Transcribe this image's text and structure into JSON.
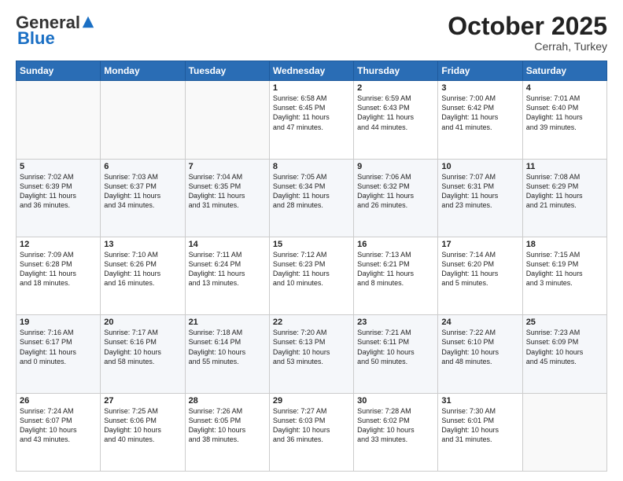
{
  "header": {
    "logo_general": "General",
    "logo_blue": "Blue",
    "month_title": "October 2025",
    "location": "Cerrah, Turkey"
  },
  "days_of_week": [
    "Sunday",
    "Monday",
    "Tuesday",
    "Wednesday",
    "Thursday",
    "Friday",
    "Saturday"
  ],
  "weeks": [
    [
      {
        "day": "",
        "info": ""
      },
      {
        "day": "",
        "info": ""
      },
      {
        "day": "",
        "info": ""
      },
      {
        "day": "1",
        "info": "Sunrise: 6:58 AM\nSunset: 6:45 PM\nDaylight: 11 hours\nand 47 minutes."
      },
      {
        "day": "2",
        "info": "Sunrise: 6:59 AM\nSunset: 6:43 PM\nDaylight: 11 hours\nand 44 minutes."
      },
      {
        "day": "3",
        "info": "Sunrise: 7:00 AM\nSunset: 6:42 PM\nDaylight: 11 hours\nand 41 minutes."
      },
      {
        "day": "4",
        "info": "Sunrise: 7:01 AM\nSunset: 6:40 PM\nDaylight: 11 hours\nand 39 minutes."
      }
    ],
    [
      {
        "day": "5",
        "info": "Sunrise: 7:02 AM\nSunset: 6:39 PM\nDaylight: 11 hours\nand 36 minutes."
      },
      {
        "day": "6",
        "info": "Sunrise: 7:03 AM\nSunset: 6:37 PM\nDaylight: 11 hours\nand 34 minutes."
      },
      {
        "day": "7",
        "info": "Sunrise: 7:04 AM\nSunset: 6:35 PM\nDaylight: 11 hours\nand 31 minutes."
      },
      {
        "day": "8",
        "info": "Sunrise: 7:05 AM\nSunset: 6:34 PM\nDaylight: 11 hours\nand 28 minutes."
      },
      {
        "day": "9",
        "info": "Sunrise: 7:06 AM\nSunset: 6:32 PM\nDaylight: 11 hours\nand 26 minutes."
      },
      {
        "day": "10",
        "info": "Sunrise: 7:07 AM\nSunset: 6:31 PM\nDaylight: 11 hours\nand 23 minutes."
      },
      {
        "day": "11",
        "info": "Sunrise: 7:08 AM\nSunset: 6:29 PM\nDaylight: 11 hours\nand 21 minutes."
      }
    ],
    [
      {
        "day": "12",
        "info": "Sunrise: 7:09 AM\nSunset: 6:28 PM\nDaylight: 11 hours\nand 18 minutes."
      },
      {
        "day": "13",
        "info": "Sunrise: 7:10 AM\nSunset: 6:26 PM\nDaylight: 11 hours\nand 16 minutes."
      },
      {
        "day": "14",
        "info": "Sunrise: 7:11 AM\nSunset: 6:24 PM\nDaylight: 11 hours\nand 13 minutes."
      },
      {
        "day": "15",
        "info": "Sunrise: 7:12 AM\nSunset: 6:23 PM\nDaylight: 11 hours\nand 10 minutes."
      },
      {
        "day": "16",
        "info": "Sunrise: 7:13 AM\nSunset: 6:21 PM\nDaylight: 11 hours\nand 8 minutes."
      },
      {
        "day": "17",
        "info": "Sunrise: 7:14 AM\nSunset: 6:20 PM\nDaylight: 11 hours\nand 5 minutes."
      },
      {
        "day": "18",
        "info": "Sunrise: 7:15 AM\nSunset: 6:19 PM\nDaylight: 11 hours\nand 3 minutes."
      }
    ],
    [
      {
        "day": "19",
        "info": "Sunrise: 7:16 AM\nSunset: 6:17 PM\nDaylight: 11 hours\nand 0 minutes."
      },
      {
        "day": "20",
        "info": "Sunrise: 7:17 AM\nSunset: 6:16 PM\nDaylight: 10 hours\nand 58 minutes."
      },
      {
        "day": "21",
        "info": "Sunrise: 7:18 AM\nSunset: 6:14 PM\nDaylight: 10 hours\nand 55 minutes."
      },
      {
        "day": "22",
        "info": "Sunrise: 7:20 AM\nSunset: 6:13 PM\nDaylight: 10 hours\nand 53 minutes."
      },
      {
        "day": "23",
        "info": "Sunrise: 7:21 AM\nSunset: 6:11 PM\nDaylight: 10 hours\nand 50 minutes."
      },
      {
        "day": "24",
        "info": "Sunrise: 7:22 AM\nSunset: 6:10 PM\nDaylight: 10 hours\nand 48 minutes."
      },
      {
        "day": "25",
        "info": "Sunrise: 7:23 AM\nSunset: 6:09 PM\nDaylight: 10 hours\nand 45 minutes."
      }
    ],
    [
      {
        "day": "26",
        "info": "Sunrise: 7:24 AM\nSunset: 6:07 PM\nDaylight: 10 hours\nand 43 minutes."
      },
      {
        "day": "27",
        "info": "Sunrise: 7:25 AM\nSunset: 6:06 PM\nDaylight: 10 hours\nand 40 minutes."
      },
      {
        "day": "28",
        "info": "Sunrise: 7:26 AM\nSunset: 6:05 PM\nDaylight: 10 hours\nand 38 minutes."
      },
      {
        "day": "29",
        "info": "Sunrise: 7:27 AM\nSunset: 6:03 PM\nDaylight: 10 hours\nand 36 minutes."
      },
      {
        "day": "30",
        "info": "Sunrise: 7:28 AM\nSunset: 6:02 PM\nDaylight: 10 hours\nand 33 minutes."
      },
      {
        "day": "31",
        "info": "Sunrise: 7:30 AM\nSunset: 6:01 PM\nDaylight: 10 hours\nand 31 minutes."
      },
      {
        "day": "",
        "info": ""
      }
    ]
  ]
}
